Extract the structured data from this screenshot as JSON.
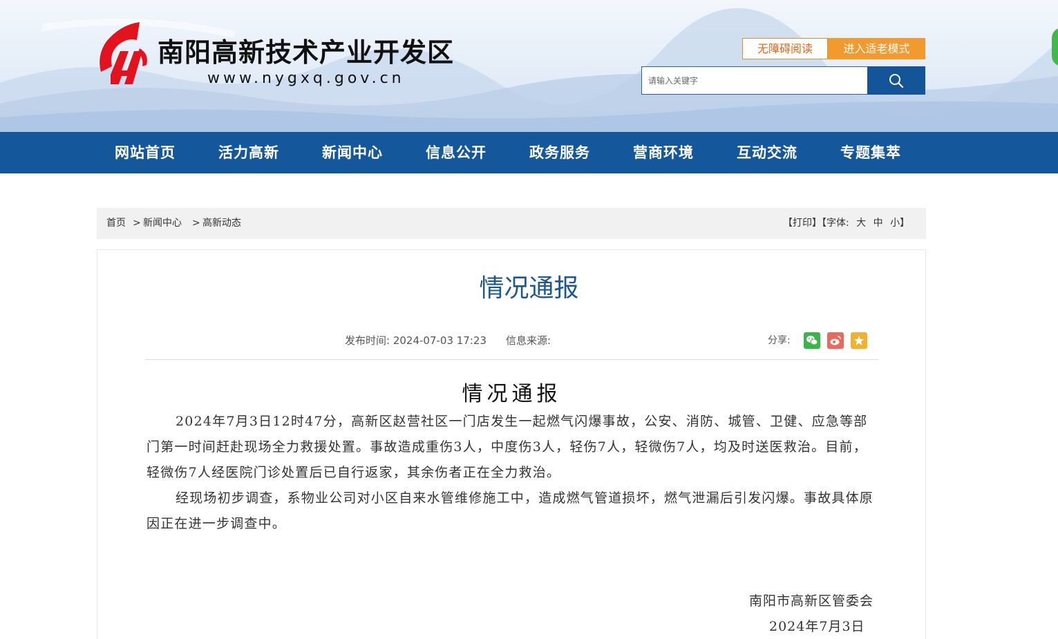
{
  "header": {
    "site_name": "南阳高新技术产业开发区",
    "site_url": "www.nygxq.gov.cn",
    "accessibility_button": "无障碍阅读",
    "elderly_mode_button": "进入适老模式",
    "search_placeholder": "请输入关键字",
    "search_icon": "search-icon",
    "colors": {
      "brand_blue": "#15579b",
      "logo_red": "#e1131e",
      "accent_orange": "#f29a2e"
    }
  },
  "nav": {
    "items": [
      "网站首页",
      "活力高新",
      "新闻中心",
      "信息公开",
      "政务服务",
      "营商环境",
      "互动交流",
      "专题集萃"
    ]
  },
  "breadcrumb": {
    "items": [
      "首页",
      "新闻中心",
      "高新动态"
    ],
    "separator": ">"
  },
  "tools": {
    "print": "【打印】",
    "font_label": "【字体:",
    "font_large": "大",
    "font_medium": "中",
    "font_small": "小",
    "font_close": "】"
  },
  "article": {
    "title": "情况通报",
    "publish_time": "发布时间:  2024-07-03 17:23",
    "source": "信息来源:",
    "share_label": "分享:",
    "share_icons": [
      "wechat-icon",
      "weibo-icon",
      "favorite-icon"
    ],
    "heading": "情况通报",
    "paragraphs": [
      "2024年7月3日12时47分，高新区赵营社区一门店发生一起燃气闪爆事故，公安、消防、城管、卫健、应急等部门第一时间赶赴现场全力救援处置。事故造成重伤3人，中度伤3人，轻伤7人，轻微伤7人，均及时送医救治。目前，轻微伤7人经医院门诊处置后已自行返家，其余伤者正在全力救治。",
      "经现场初步调查，系物业公司对小区自来水管维修施工中，造成燃气管道损坏，燃气泄漏后引发闪爆。事故具体原因正在进一步调查中。"
    ],
    "signature": "南阳市高新区管委会",
    "date": "2024年7月3日"
  }
}
